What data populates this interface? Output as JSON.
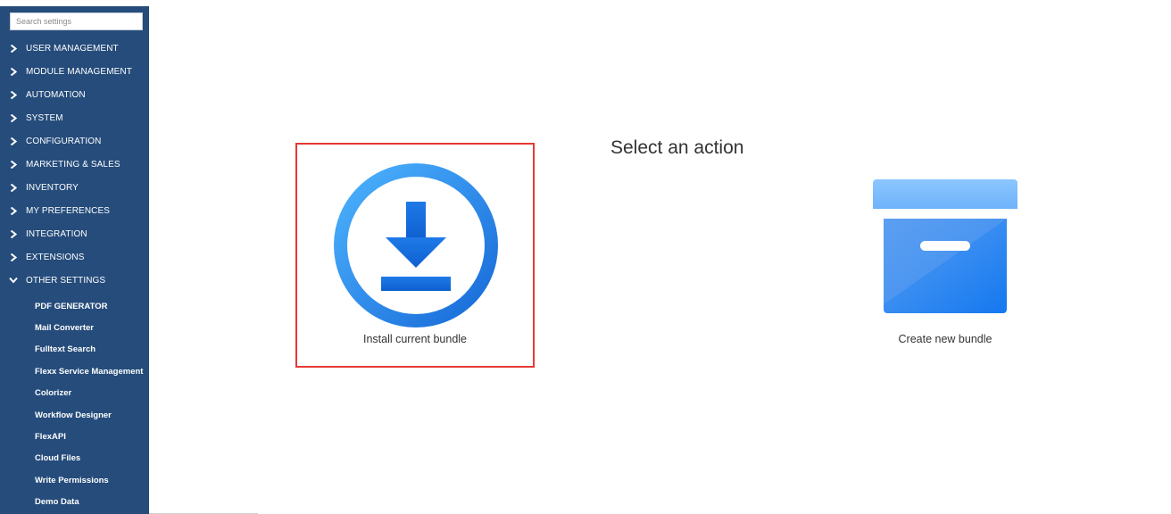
{
  "sidebar": {
    "search_placeholder": "Search settings",
    "items": [
      {
        "label": "USER MANAGEMENT",
        "icon": "chevron-right-icon"
      },
      {
        "label": "MODULE MANAGEMENT",
        "icon": "chevron-right-icon"
      },
      {
        "label": "AUTOMATION",
        "icon": "chevron-right-icon"
      },
      {
        "label": "SYSTEM",
        "icon": "chevron-right-icon"
      },
      {
        "label": "CONFIGURATION",
        "icon": "chevron-right-icon"
      },
      {
        "label": "MARKETING & SALES",
        "icon": "chevron-right-icon"
      },
      {
        "label": "INVENTORY",
        "icon": "chevron-right-icon"
      },
      {
        "label": "MY PREFERENCES",
        "icon": "chevron-right-icon"
      },
      {
        "label": "INTEGRATION",
        "icon": "chevron-right-icon"
      },
      {
        "label": "EXTENSIONS",
        "icon": "chevron-right-icon"
      },
      {
        "label": "OTHER SETTINGS",
        "icon": "chevron-down-icon",
        "expanded": true
      }
    ],
    "subitems": [
      "PDF GENERATOR",
      "Mail Converter",
      "Fulltext Search",
      "Flexx Service Management",
      "Colorizer",
      "Workflow Designer",
      "FlexAPI",
      "Cloud Files",
      "Write Permissions",
      "Demo Data"
    ],
    "background": "#254c7b"
  },
  "main": {
    "title": "Select an action",
    "actions": [
      {
        "label": "Install current bundle",
        "icon": "download-icon",
        "selected": true
      },
      {
        "label": "Create new bundle",
        "icon": "archive-box-icon",
        "selected": false
      }
    ],
    "selection_color": "#e53935"
  }
}
